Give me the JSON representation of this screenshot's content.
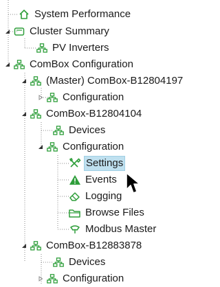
{
  "tree": {
    "system_performance": "System Performance",
    "cluster_summary": "Cluster Summary",
    "pv_inverters": "PV Inverters",
    "combox_configuration": "ComBox Configuration",
    "master_combox": "(Master) ComBox-B12804197",
    "master_configuration": "Configuration",
    "combox_b12804104": "ComBox-B12804104",
    "devices_1": "Devices",
    "configuration_1": "Configuration",
    "settings": "Settings",
    "events": "Events",
    "logging": "Logging",
    "browse_files": "Browse Files",
    "modbus_master": "Modbus Master",
    "combox_b12883878": "ComBox-B12883878",
    "devices_2": "Devices",
    "configuration_2": "Configuration",
    "selected_item": "Settings"
  },
  "colors": {
    "green_icon": "#2e9e3a",
    "selection_bg": "#bfe0ef",
    "tree_lines": "#8a8a8a"
  },
  "icons": {
    "system_performance": "home-icon",
    "cluster_summary": "cluster-icon",
    "network_node": "network-node-icon",
    "settings": "tools-icon",
    "events": "warning-icon",
    "logging": "eraser-icon",
    "browse_files": "folder-icon",
    "modbus_master": "plug-icon",
    "cursor": "mouse-pointer-icon"
  }
}
